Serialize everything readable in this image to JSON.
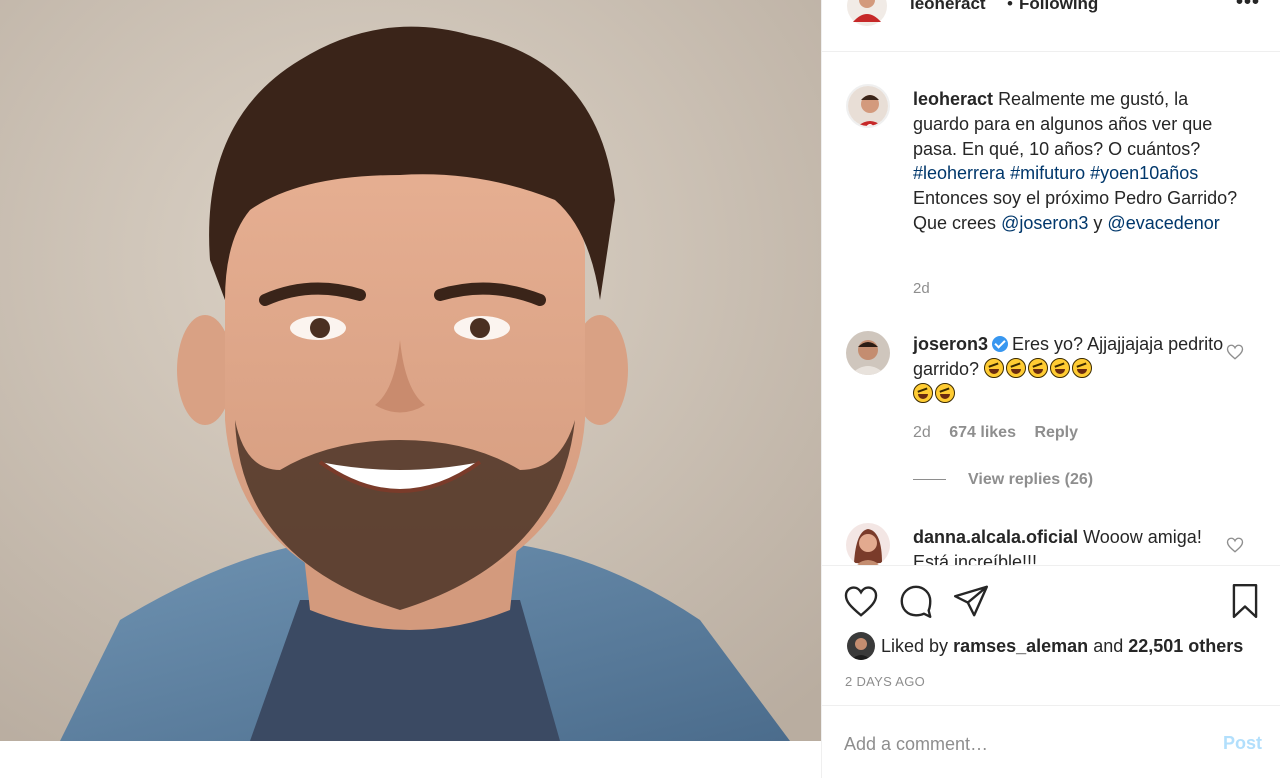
{
  "header": {
    "username": "leoheract",
    "separator": "•",
    "follow_status": "Following",
    "more_label": "•••"
  },
  "caption": {
    "username": "leoheract",
    "text_1": "Realmente me gustó, la guardo para en algunos años ver que pasa. En qué, 10 años? O cuántos?",
    "hashtags": [
      "#leoherrera",
      "#mifuturo",
      "#yoen10años"
    ],
    "text_2": "Entonces soy el próximo Pedro Garrido? Que crees",
    "mention_1": "@joseron3",
    "conj": "y",
    "mention_2": "@evacedenor",
    "time": "2d"
  },
  "comments": [
    {
      "username": "joseron3",
      "verified": true,
      "text": "Eres yo? Ajjajjajaja pedrito garrido?",
      "emoji_count": 7,
      "time": "2d",
      "likes": "674 likes",
      "reply_label": "Reply",
      "view_replies": "View replies (26)"
    },
    {
      "username": "danna.alcala.oficial",
      "text": "Wooow amiga! Está increíble!!!"
    }
  ],
  "likes": {
    "prefix": "Liked by",
    "user": "ramses_aleman",
    "and": "and",
    "others": "22,501 others"
  },
  "posted_ago": "2 DAYS AGO",
  "add_comment": {
    "placeholder": "Add a comment…",
    "post_label": "Post"
  },
  "colors": {
    "link": "#00376b",
    "muted": "#8e8e8e",
    "verified": "#3897f0",
    "post_disabled": "#b2dffc"
  }
}
